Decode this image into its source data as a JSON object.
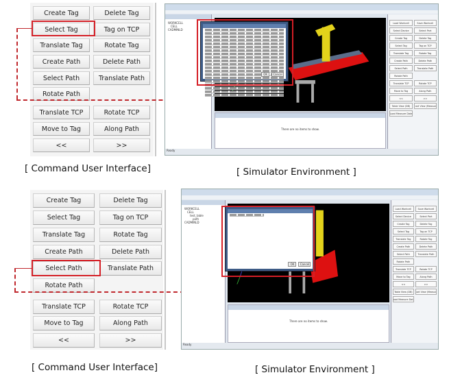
{
  "colors": {
    "highlight": "#d51f26",
    "dashed_line": "#c0282d"
  },
  "top": {
    "command_ui": {
      "buttons": [
        [
          "Create Tag",
          "Delete Tag"
        ],
        [
          "Select Tag",
          "Tag on TCP"
        ],
        [
          "Translate Tag",
          "Rotate Tag"
        ],
        [
          "Create Path",
          "Delete Path"
        ],
        [
          "Select Path",
          "Translate Path"
        ],
        [
          "Rotate Path",
          ""
        ],
        [
          "Translate TCP",
          "Rotate TCP"
        ],
        [
          "Move to Tag",
          "Along Path"
        ],
        [
          "<<",
          ">>"
        ]
      ],
      "highlighted": "Select Tag",
      "caption": "[ Command User Interface]"
    },
    "simulator": {
      "caption": "[ Simulator Environment ]",
      "dialog": {
        "ok": "OK",
        "cancel": "Cancel"
      },
      "tree": [
        "WORKCELL",
        "CELL",
        "CADMINLD"
      ],
      "output_text": "There are no items to show.",
      "status": "Ready"
    }
  },
  "bottom": {
    "command_ui": {
      "buttons": [
        [
          "Create Tag",
          "Delete Tag"
        ],
        [
          "Select Tag",
          "Tag on TCP"
        ],
        [
          "Translate Tag",
          "Rotate Tag"
        ],
        [
          "Create Path",
          "Delete Path"
        ],
        [
          "Select Path",
          "Translate Path"
        ],
        [
          "Rotate Path",
          ""
        ],
        [
          "Translate TCP",
          "Rotate TCP"
        ],
        [
          "Move to Tag",
          "Along Path"
        ],
        [
          "<<",
          ">>"
        ]
      ],
      "highlighted": "Select Path",
      "caption": "[ Command User Interface]"
    },
    "simulator": {
      "caption": "[ Simulator Environment ]",
      "dialog": {
        "ok": "OK",
        "cancel": "Cancel"
      },
      "tree": [
        "WORKCELL",
        "CELL",
        "test_table",
        "path",
        "CADMINLD"
      ],
      "output_text": "There are no items to show.",
      "status": "Ready"
    }
  },
  "sim_buttons": [
    "Load Workcell",
    "Save Workcell",
    "Select Device",
    "Select Part",
    "Create Tag",
    "Delete Tag",
    "Select Tag",
    "Tag on TCP",
    "Translate Tag",
    "Rotate Tag",
    "Create Path",
    "Delete Path",
    "Select Path",
    "Translate Path",
    "Rotate Path",
    "",
    "Translate TCP",
    "Rotate TCP",
    "Move to Tag",
    "Along Path",
    "<<",
    ">>",
    "Table View (DB)",
    "Chart View (Measure)",
    "Load Measure Data"
  ]
}
